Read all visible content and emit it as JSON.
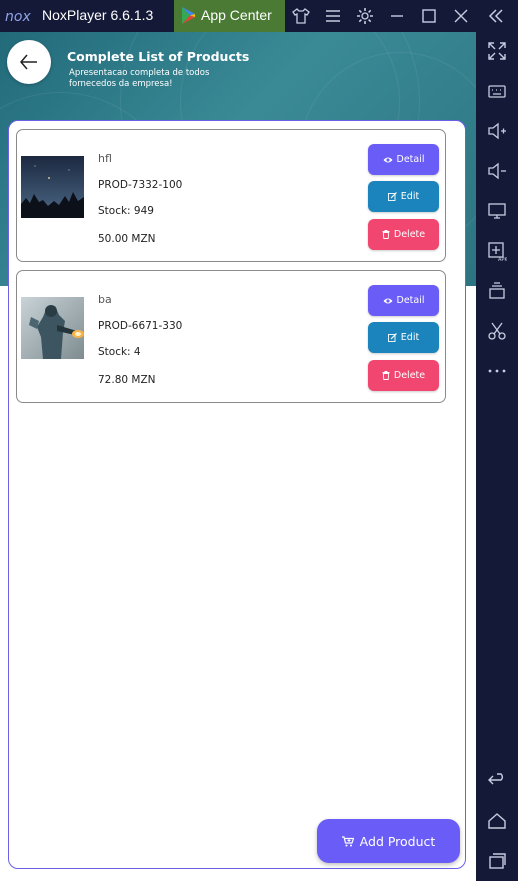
{
  "emulator": {
    "app_title": "NoxPlayer 6.6.1.3",
    "app_center_label": "App Center",
    "title_icons": [
      "shirt-icon",
      "menu-icon",
      "gear-icon",
      "minimize-icon",
      "maximize-icon",
      "close-icon",
      "collapse-icon"
    ],
    "sidebar_icons": [
      "fullscreen-icon",
      "keyboard-icon",
      "volume-up-icon",
      "volume-down-icon",
      "screen-icon",
      "apk-install-icon",
      "multi-instance-icon",
      "scissors-icon",
      "more-icon",
      "back-nav-icon",
      "home-nav-icon",
      "recent-apps-icon"
    ]
  },
  "header": {
    "title": "Complete List of Products",
    "subtitle": "Apresentacao completa de todos fornecedos da empresa!"
  },
  "products": [
    {
      "name": "hfl",
      "code": "PROD-7332-100",
      "stock": "Stock: 949",
      "price": "50.00 MZN",
      "image": "night-sky-trees"
    },
    {
      "name": "ba",
      "code": "PROD-6671-330",
      "stock": "Stock: 4",
      "price": "72.80 MZN",
      "image": "armored-soldier"
    }
  ],
  "actions": {
    "detail": "Detail",
    "edit": "Edit",
    "delete": "Delete"
  },
  "add_button": "Add Product",
  "colors": {
    "titlebar": "#141938",
    "app_center": "#4a7a33",
    "header": "#2d7482",
    "detail": "#6a5cf6",
    "edit": "#1b84bd",
    "delete": "#f0466f",
    "panel_border": "#6a60e8"
  }
}
